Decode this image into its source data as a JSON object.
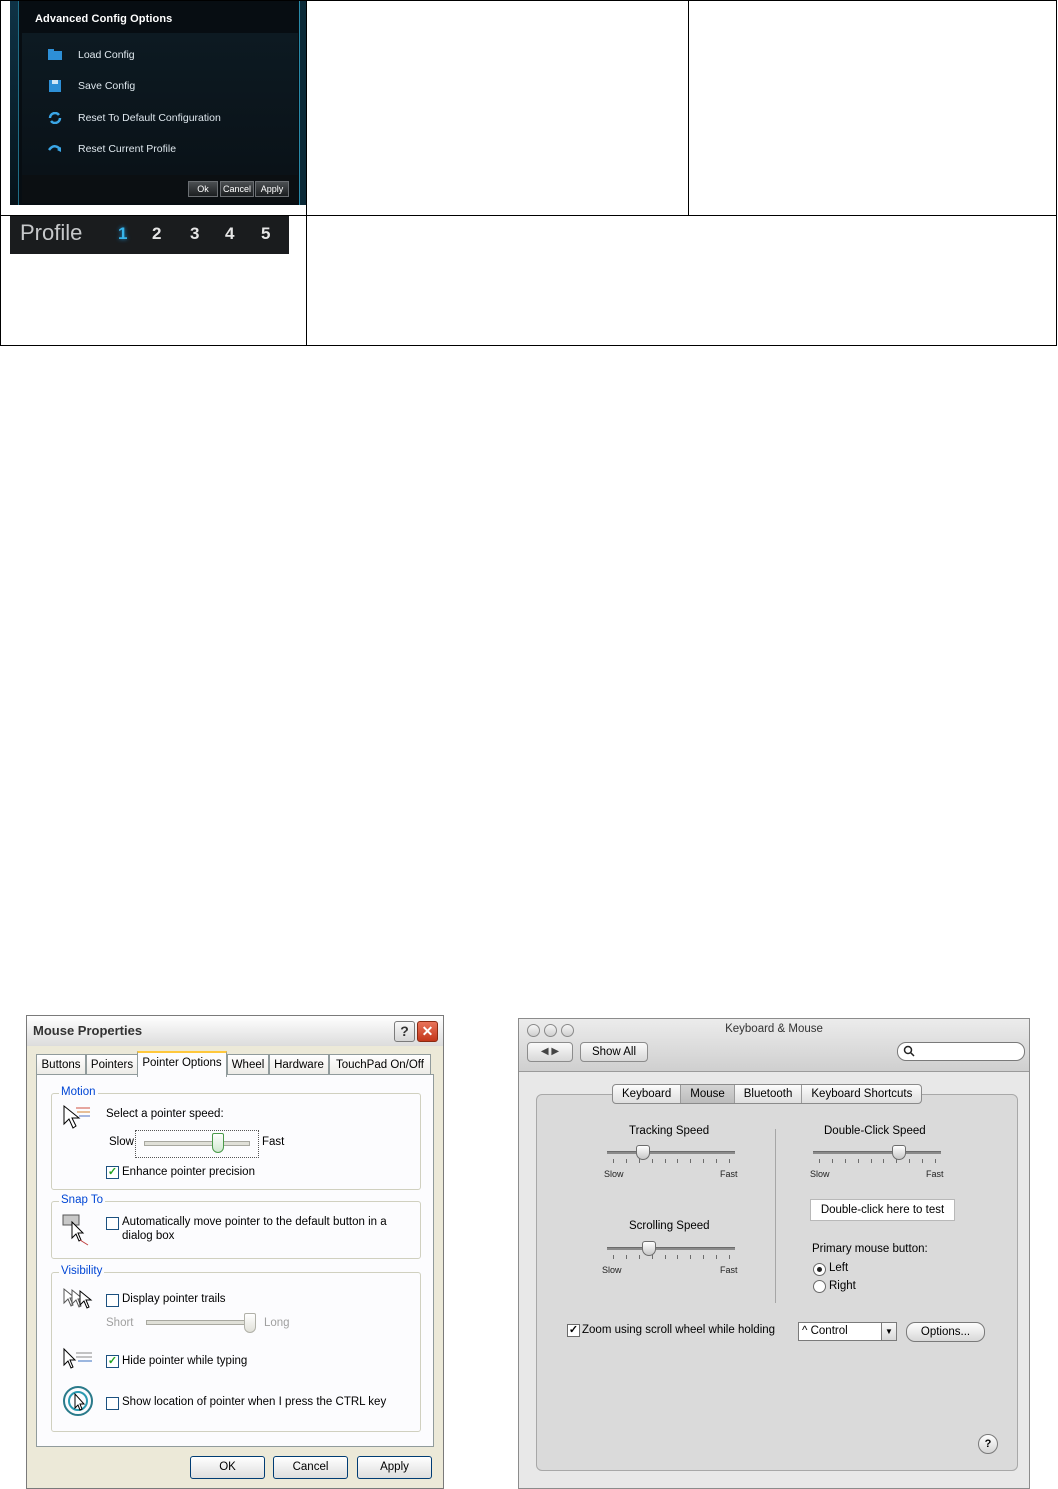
{
  "advanced_config": {
    "title": "Advanced Config Options",
    "items": [
      {
        "label": "Load Config",
        "icon": "folder-icon"
      },
      {
        "label": "Save Config",
        "icon": "floppy-disk-icon"
      },
      {
        "label": "Reset To Default Configuration",
        "icon": "refresh-icon"
      },
      {
        "label": "Reset Current Profile",
        "icon": "undo-arrow-icon"
      }
    ],
    "buttons": {
      "ok": "Ok",
      "cancel": "Cancel",
      "apply": "Apply"
    },
    "colors": {
      "background": "#070d12",
      "frame_accent": "#2a8aa8"
    }
  },
  "profile_bar": {
    "label": "Profile",
    "numbers": [
      "1",
      "2",
      "3",
      "4",
      "5"
    ],
    "active": "1",
    "colors": {
      "active": "#37b4ea",
      "inactive": "#e6e6e6"
    }
  },
  "mouse_properties": {
    "title": "Mouse Properties",
    "title_buttons": {
      "help": "?",
      "close": "✕"
    },
    "tabs": [
      "Buttons",
      "Pointers",
      "Pointer Options",
      "Wheel",
      "Hardware",
      "TouchPad On/Off"
    ],
    "active_tab": "Pointer Options",
    "motion": {
      "legend": "Motion",
      "speed_label": "Select a pointer speed:",
      "slow": "Slow",
      "fast": "Fast",
      "speed_fraction": 0.7,
      "enhance_precision": {
        "label": "Enhance pointer precision",
        "checked": true
      }
    },
    "snap_to": {
      "legend": "Snap To",
      "auto_move": {
        "label_line1": "Automatically move pointer to the default button in a",
        "label_line2": "dialog box",
        "checked": false
      }
    },
    "visibility": {
      "legend": "Visibility",
      "trails": {
        "label": "Display pointer trails",
        "checked": false
      },
      "short": "Short",
      "long": "Long",
      "trail_fraction": 1.0,
      "hide_typing": {
        "label": "Hide pointer while typing",
        "checked": true
      },
      "show_location": {
        "label": "Show location of pointer when I press the CTRL key",
        "checked": false
      }
    },
    "buttons": {
      "ok": "OK",
      "cancel": "Cancel",
      "apply": "Apply"
    }
  },
  "keyboard_mouse": {
    "title": "Keyboard & Mouse",
    "nav_arrows": "◀ ▶",
    "show_all": "Show All",
    "search_icon": "magnifier-icon",
    "search_placeholder": "",
    "tabs": [
      "Keyboard",
      "Mouse",
      "Bluetooth",
      "Keyboard Shortcuts"
    ],
    "active_tab": "Mouse",
    "tracking_speed": {
      "label": "Tracking Speed",
      "slow": "Slow",
      "fast": "Fast",
      "fraction": 0.25
    },
    "scrolling_speed": {
      "label": "Scrolling Speed",
      "slow": "Slow",
      "fast": "Fast",
      "fraction": 0.3
    },
    "double_click_speed": {
      "label": "Double-Click Speed",
      "slow": "Slow",
      "fast": "Fast",
      "fraction": 0.68
    },
    "test_area": "Double-click here to test",
    "primary_button": {
      "label": "Primary mouse button:",
      "options": [
        "Left",
        "Right"
      ],
      "selected": "Left"
    },
    "zoom": {
      "label": "Zoom using scroll wheel while holding",
      "checked": true,
      "modifier": "^ Control"
    },
    "options_button": "Options...",
    "help": "?"
  }
}
